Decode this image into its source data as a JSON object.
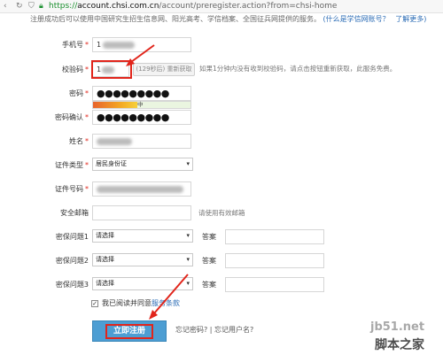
{
  "browser": {
    "url_proto": "https://",
    "url_domain": "account.chsi.com.cn",
    "url_path": "/account/preregister.action?from=chsi-home"
  },
  "notice": {
    "text": "注册成功后可以使用中国研究生招生信息网、阳光高考、学信档案、全国征兵网提供的服务。",
    "link1": "(什么是学信网账号？",
    "link2": "了解更多)"
  },
  "form": {
    "phone": {
      "label": "手机号",
      "value": "1"
    },
    "code": {
      "label": "校验码",
      "value": "1",
      "countdown": "(129秒后)",
      "resend": "重新获取",
      "hint": "如果1分钟内没有收到校验码，请点击按钮重新获取，此服务免费。"
    },
    "password": {
      "label": "密码",
      "value": "●●●●●●●●●"
    },
    "strength": {
      "label": "中",
      "level": 0.45
    },
    "password_confirm": {
      "label": "密码确认",
      "value": "●●●●●●●●●"
    },
    "name": {
      "label": "姓名"
    },
    "id_type": {
      "label": "证件类型",
      "value": "居民身份证"
    },
    "id_number": {
      "label": "证件号码"
    },
    "email": {
      "label": "安全邮箱",
      "hint": "请使用有效邮箱"
    },
    "q1": {
      "label": "密保问题1",
      "value": "请选择",
      "answer_label": "答案"
    },
    "q2": {
      "label": "密保问题2",
      "value": "请选择",
      "answer_label": "答案"
    },
    "q3": {
      "label": "密保问题3",
      "value": "请选择",
      "answer_label": "答案"
    },
    "agree": {
      "checked": "✓",
      "text": "我已阅读并同意",
      "link": "服务条款"
    },
    "submit": "立即注册",
    "forgot_password": "忘记密码?",
    "sep": " | ",
    "forgot_user": "忘记用户名?"
  },
  "watermark": {
    "line1": "jb51.net",
    "line2": "脚本之家"
  },
  "colors": {
    "accent": "#4d9ed3",
    "highlight": "#e1251b",
    "link": "#2a6bb5"
  }
}
